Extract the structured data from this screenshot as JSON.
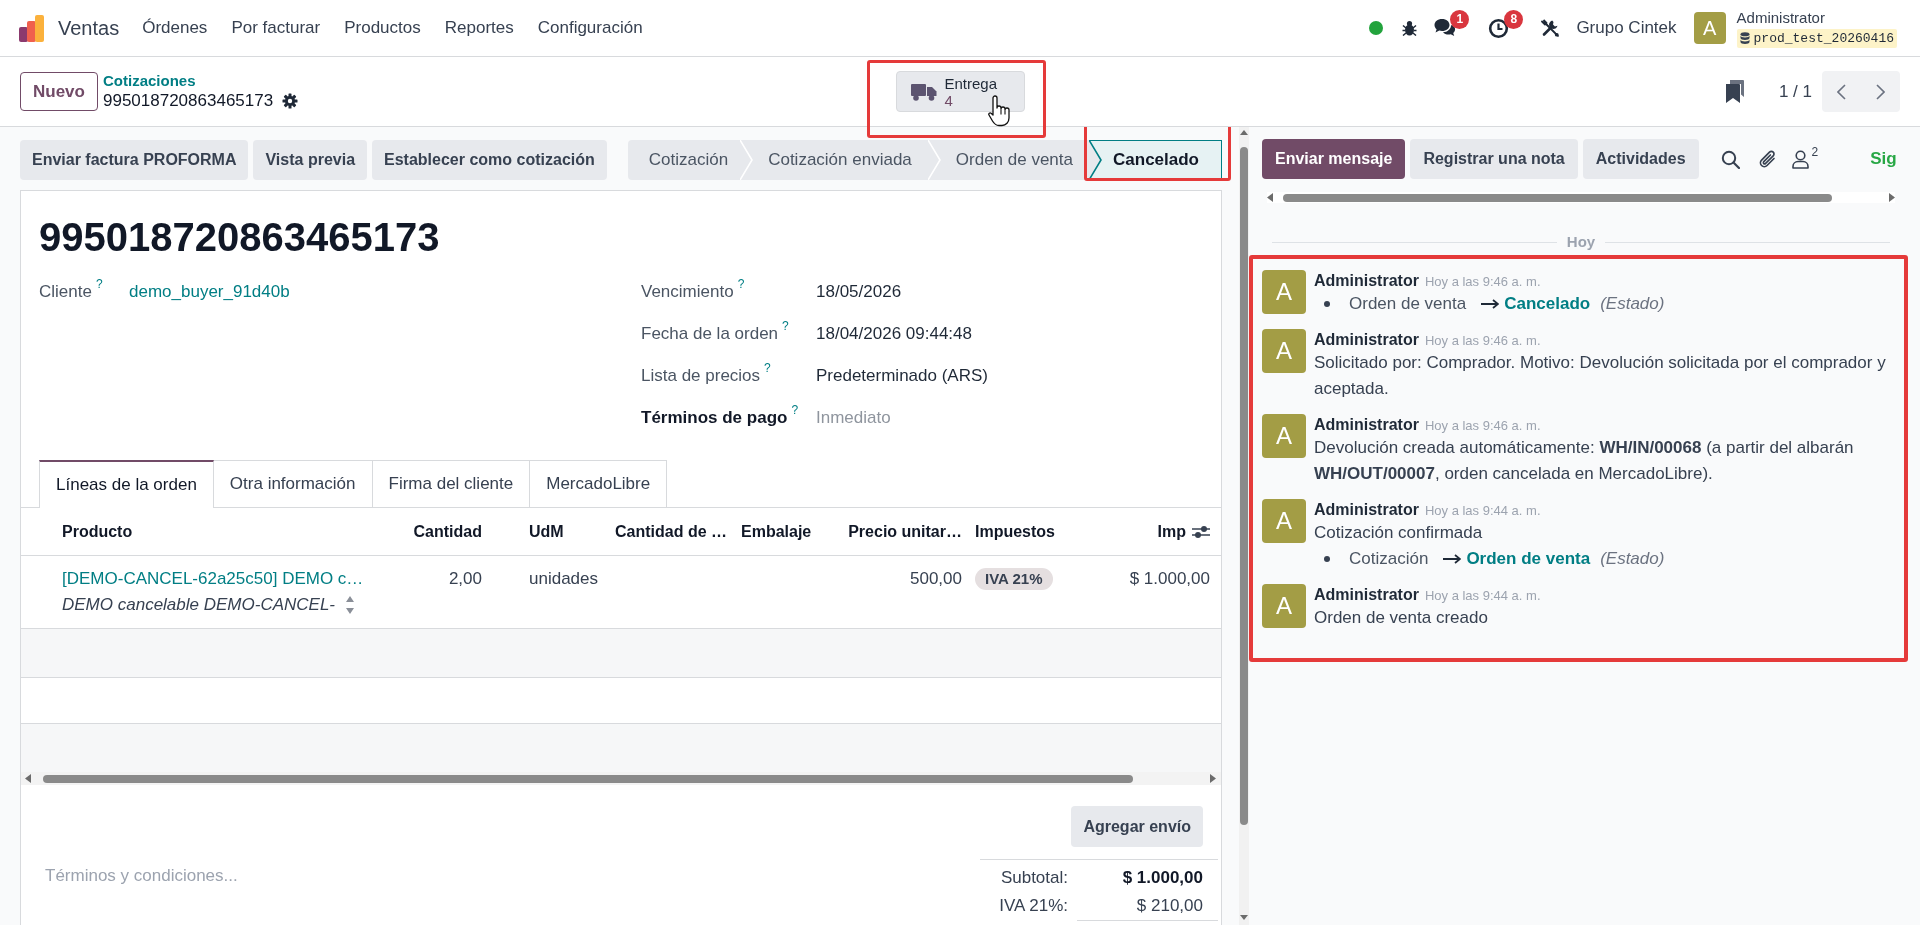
{
  "navbar": {
    "app_name": "Ventas",
    "menu": [
      "Órdenes",
      "Por facturar",
      "Productos",
      "Reportes",
      "Configuración"
    ],
    "notifications": [
      {
        "kind": "chat",
        "badge": "1"
      },
      {
        "kind": "activity",
        "badge": "8"
      }
    ],
    "company": "Grupo Cintek",
    "user": {
      "avatar": "A",
      "name": "Administrator",
      "database": "prod_test_20260416"
    }
  },
  "control_panel": {
    "new_button": "Nuevo",
    "breadcrumb": "Cotizaciones",
    "record": "995018720863465173",
    "smart_button": {
      "label": "Entrega",
      "count": "4",
      "highlighted": true,
      "hovered": true
    },
    "pager": "1 / 1"
  },
  "action_buttons": [
    "Enviar factura PROFORMA",
    "Vista previa",
    "Establecer como cotización"
  ],
  "statusbar": [
    {
      "label": "Cotización",
      "selected": false,
      "highlighted": false
    },
    {
      "label": "Cotización enviada",
      "selected": false,
      "highlighted": false
    },
    {
      "label": "Orden de venta",
      "selected": false,
      "highlighted": false
    },
    {
      "label": "Cancelado",
      "selected": true,
      "highlighted": true
    }
  ],
  "form": {
    "title": "995018720863465173",
    "left_fields": [
      {
        "label": "Cliente",
        "help": "?",
        "kind": "link",
        "value": "demo_buyer_91d40b",
        "required": false
      }
    ],
    "right_fields": [
      {
        "label": "Vencimiento",
        "help": "?",
        "kind": "text",
        "value": "18/05/2026",
        "required": false
      },
      {
        "label": "Fecha de la orden",
        "help": "?",
        "kind": "text",
        "value": "18/04/2026 09:44:48",
        "required": false
      },
      {
        "label": "Lista de precios",
        "help": "?",
        "kind": "text",
        "value": "Predeterminado (ARS)",
        "required": false
      },
      {
        "label": "Términos de pago",
        "help": "?",
        "kind": "input",
        "placeholder": "Inmediato",
        "required": true
      }
    ],
    "tabs": [
      {
        "label": "Líneas de la orden",
        "selected": true
      },
      {
        "label": "Otra información",
        "selected": false
      },
      {
        "label": "Firma del cliente",
        "selected": false
      },
      {
        "label": "MercadoLibre",
        "selected": false
      }
    ],
    "table": {
      "columns": [
        "Producto",
        "Cantidad",
        "UdM",
        "Cantidad de …",
        "Embalaje",
        "Precio unitar…",
        "Impuestos",
        "Imp"
      ],
      "rows": [
        {
          "product": "[DEMO-CANCEL-62a25c50] DEMO c…",
          "description": "DEMO cancelable DEMO-CANCEL-",
          "quantity": "2,00",
          "uom": "unidades",
          "unit_price": "500,00",
          "taxes": [
            "IVA 21%"
          ],
          "amount": "$ 1.000,00"
        }
      ]
    },
    "add_shipping_button": "Agregar envío",
    "terms": {
      "placeholder": "Términos y condiciones..."
    },
    "totals": [
      {
        "label": "Subtotal:",
        "value": "$ 1.000,00",
        "bold": true
      },
      {
        "label": "IVA 21%:",
        "value": "$ 210,00",
        "bold": false
      }
    ]
  },
  "chatter": {
    "buttons": [
      {
        "label": "Enviar mensaje",
        "primary": true
      },
      {
        "label": "Registrar una nota",
        "primary": false
      },
      {
        "label": "Actividades",
        "primary": false
      }
    ],
    "followers_count": "2",
    "follow_button": "Sig",
    "date_separator": "Hoy",
    "messages_highlighted": true,
    "messages": [
      {
        "avatar": "A",
        "author": "Administrator",
        "time": "Hoy a las 9:46 a. m.",
        "tracking": [
          {
            "old": "Orden de venta",
            "new": "Cancelado",
            "field": "(Estado)"
          }
        ]
      },
      {
        "avatar": "A",
        "author": "Administrator",
        "time": "Hoy a las 9:46 a. m.",
        "body": "Solicitado por: Comprador. Motivo: Devolución solicitada por el comprador y aceptada."
      },
      {
        "avatar": "A",
        "author": "Administrator",
        "time": "Hoy a las 9:46 a. m.",
        "body": "Devolución creada automáticamente: **WH/IN/00068** (a partir del albarán **WH/OUT/00007**, orden cancelada en MercadoLibre)."
      },
      {
        "avatar": "A",
        "author": "Administrator",
        "time": "Hoy a las 9:44 a. m.",
        "body": "Cotización confirmada",
        "tracking": [
          {
            "old": "Cotización",
            "new": "Orden de venta",
            "field": "(Estado)"
          }
        ]
      },
      {
        "avatar": "A",
        "author": "Administrator",
        "time": "Hoy a las 9:44 a. m.",
        "body": "Orden de venta creado"
      }
    ]
  }
}
